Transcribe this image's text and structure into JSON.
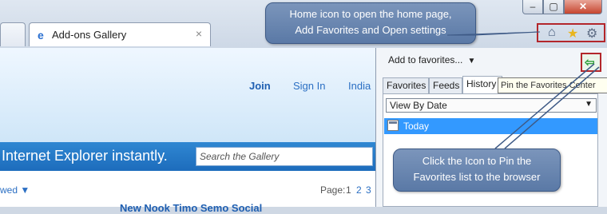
{
  "browser": {
    "tab_title": "Add-ons Gallery",
    "tab_close_glyph": "×",
    "window_buttons": {
      "minimize": "–",
      "maximize": "▢",
      "close": "✕"
    },
    "toolbar_icons": [
      "home-icon",
      "star-icon",
      "gear-icon"
    ]
  },
  "callouts": {
    "top_line1": "Home icon to open the home page,",
    "top_line2": "Add Favorites and Open settings",
    "bottom_line1": "Click the Icon to Pin the",
    "bottom_line2": "Favorites list to the browser"
  },
  "page": {
    "nav": {
      "join": "Join",
      "sign_in": "Sign In",
      "region": "India"
    },
    "banner_text": "Internet Explorer instantly.",
    "search_placeholder": "Search the Gallery",
    "viewed_label": "wed",
    "pager": {
      "label": "Page:",
      "pages": [
        "1",
        "2",
        "3"
      ]
    },
    "cut_heading": "New Nook Timo Semo Social"
  },
  "favorites_center": {
    "add_label": "Add to favorites...",
    "tabs": [
      "Favorites",
      "Feeds",
      "History"
    ],
    "pin_tooltip": "Pin the Favorites Center",
    "view_by": "View By Date",
    "history_items": [
      "Today"
    ]
  },
  "colors": {
    "accent": "#3399ff",
    "highlight_border": "#b3262b",
    "callout": "#5a79a6"
  }
}
